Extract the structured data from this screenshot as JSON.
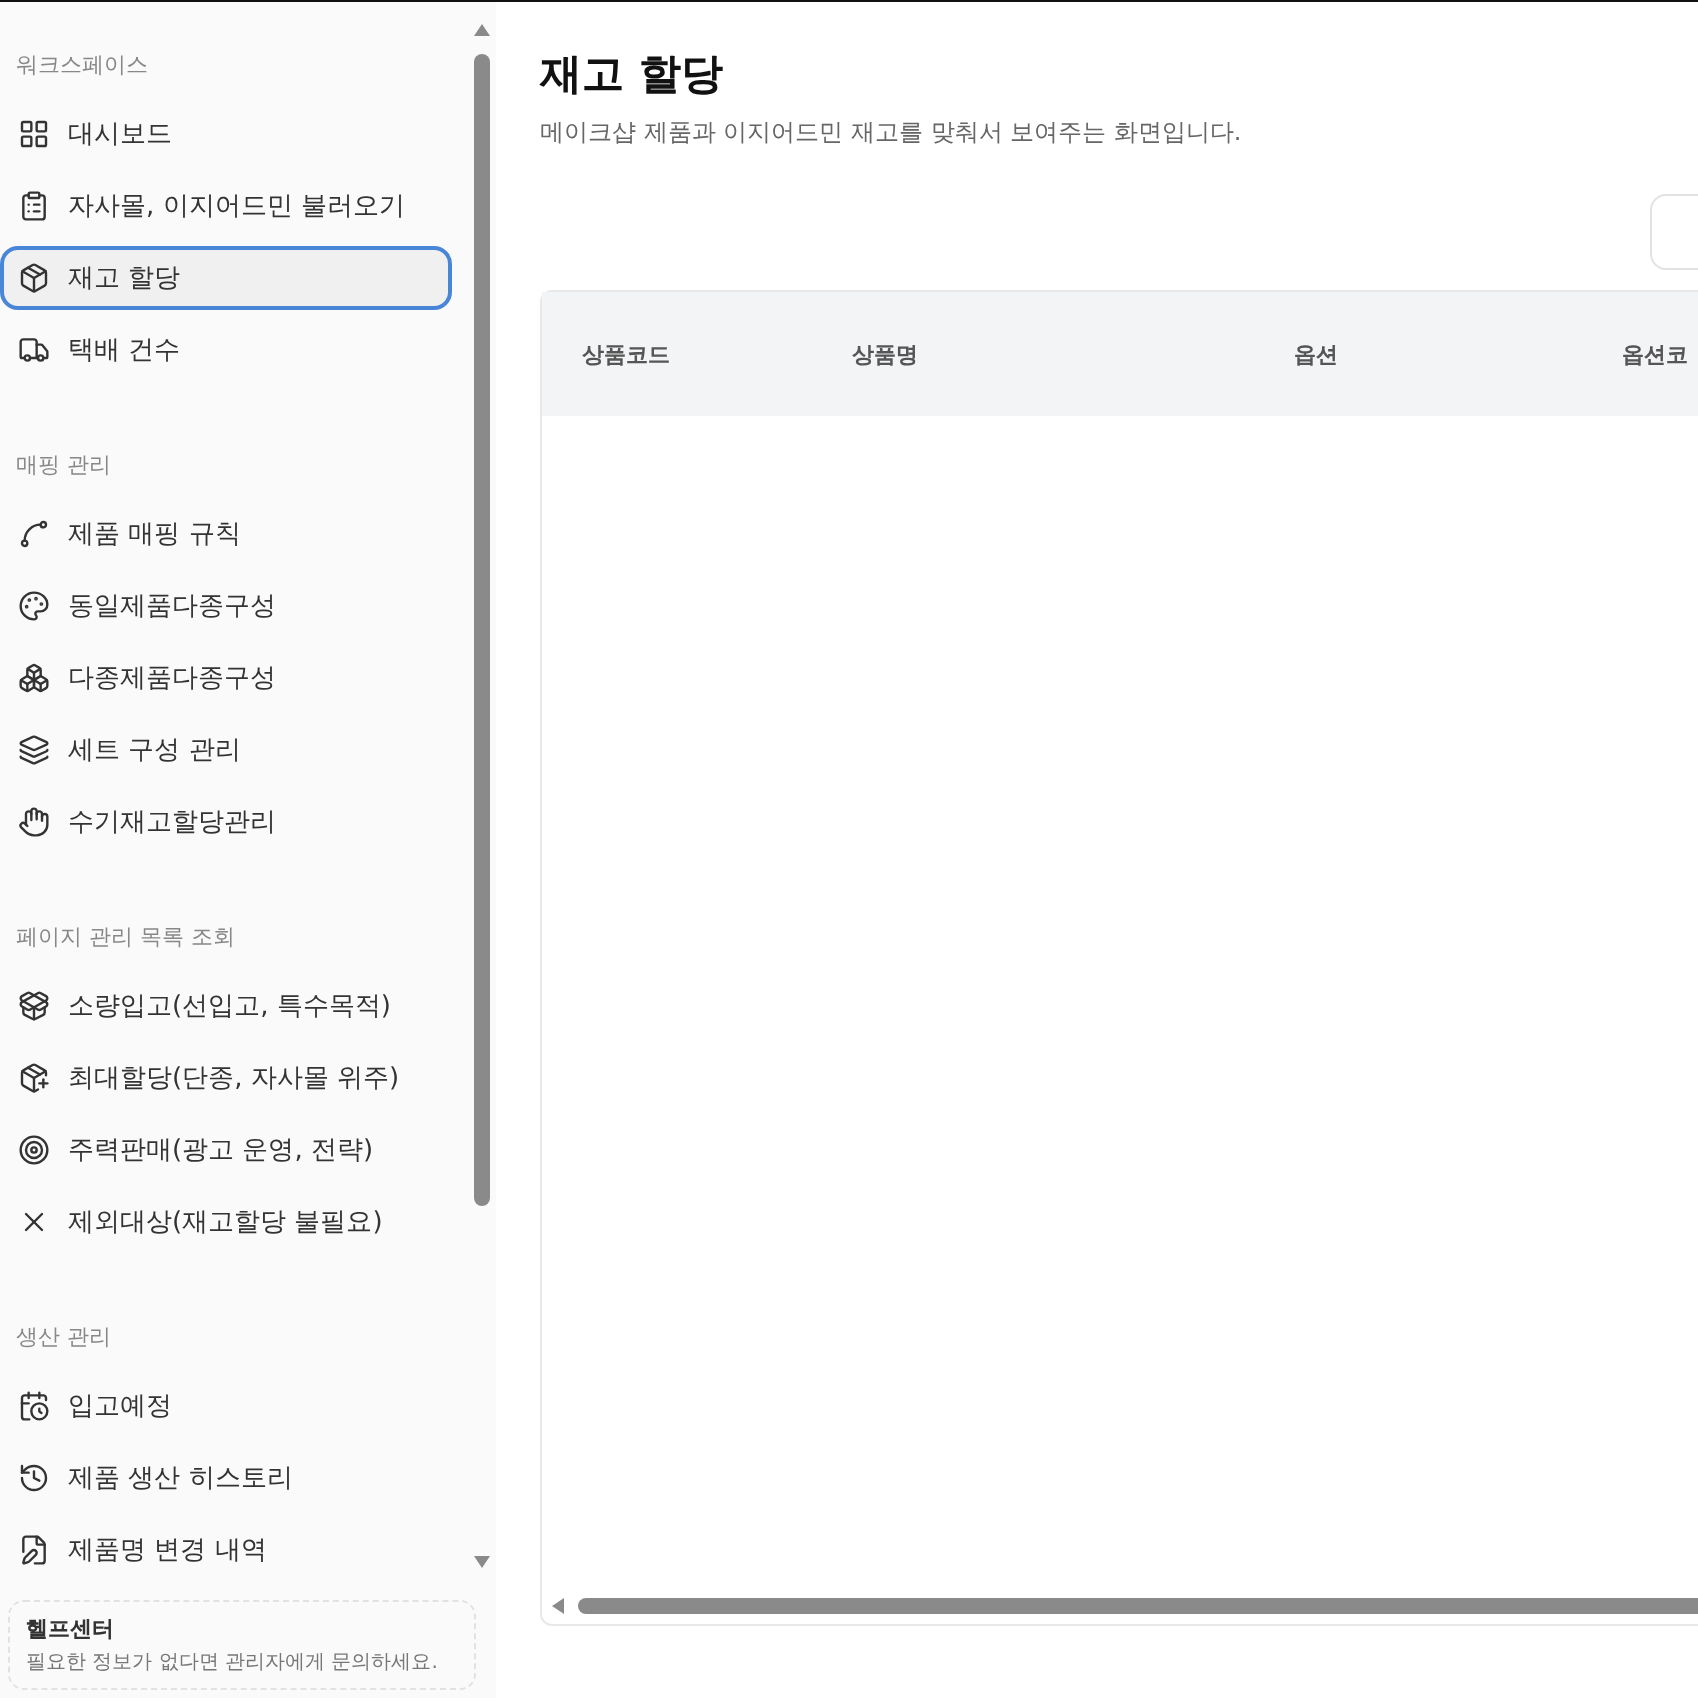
{
  "sidebar": {
    "sections": [
      {
        "heading": "워크스페이스",
        "items": [
          {
            "label": "대시보드",
            "selected": false
          },
          {
            "label": "자사몰, 이지어드민 불러오기",
            "selected": false
          },
          {
            "label": "재고 할당",
            "selected": true
          },
          {
            "label": "택배 건수",
            "selected": false
          }
        ]
      },
      {
        "heading": "매핑 관리",
        "items": [
          {
            "label": "제품 매핑 규칙",
            "selected": false
          },
          {
            "label": "동일제품다종구성",
            "selected": false
          },
          {
            "label": "다종제품다종구성",
            "selected": false
          },
          {
            "label": "세트 구성 관리",
            "selected": false
          },
          {
            "label": "수기재고할당관리",
            "selected": false
          }
        ]
      },
      {
        "heading": "페이지 관리 목록 조회",
        "items": [
          {
            "label": "소량입고(선입고, 특수목적)",
            "selected": false
          },
          {
            "label": "최대할당(단종, 자사몰 위주)",
            "selected": false
          },
          {
            "label": "주력판매(광고 운영, 전략)",
            "selected": false
          },
          {
            "label": "제외대상(재고할당 불필요)",
            "selected": false
          }
        ]
      },
      {
        "heading": "생산 관리",
        "items": [
          {
            "label": "입고예정",
            "selected": false
          },
          {
            "label": "제품 생산 히스토리",
            "selected": false
          },
          {
            "label": "제품명 변경 내역",
            "selected": false
          }
        ]
      }
    ],
    "help": {
      "title": "헬프센터",
      "text": "필요한 정보가 없다면 관리자에게 문의하세요."
    }
  },
  "page": {
    "title": "재고 할당",
    "subtitle": "메이크샵 제품과 이지어드민 재고를 맞춰서 보여주는 화면입니다."
  },
  "table": {
    "columns": [
      "상품코드",
      "상품명",
      "옵션",
      "옵션코"
    ]
  }
}
